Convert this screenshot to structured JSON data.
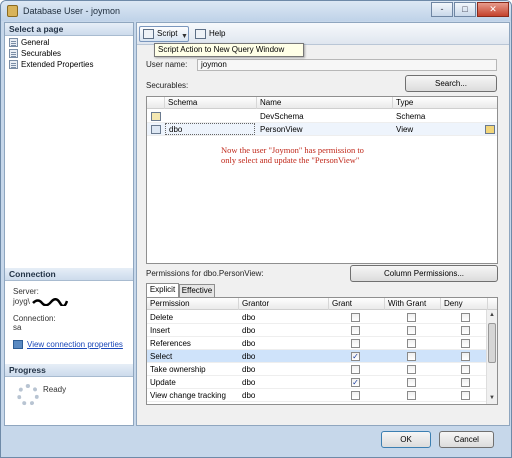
{
  "window": {
    "title": "Database User - joymon",
    "controls": [
      "-",
      "□",
      "✕"
    ]
  },
  "left": {
    "select_page_header": "Select a page",
    "pages": [
      "General",
      "Securables",
      "Extended Properties"
    ],
    "connection_header": "Connection",
    "server_label": "Server:",
    "server_value": "joyg\\",
    "connection_label": "Connection:",
    "connection_value": "sa",
    "view_connection_link": "View connection properties",
    "progress_header": "Progress",
    "progress_status": "Ready"
  },
  "toolbar": {
    "script_label": "Script",
    "help_label": "Help",
    "tooltip": "Script Action to New Query Window"
  },
  "form": {
    "user_name_label": "User name:",
    "user_name_value": "joymon",
    "securables_label": "Securables:",
    "search_button": "Search..."
  },
  "securables_table": {
    "headers": [
      "Schema",
      "Name",
      "Type"
    ],
    "rows": [
      {
        "schema": "",
        "name": "DevSchema",
        "type": "Schema"
      },
      {
        "schema": "dbo",
        "name": "PersonView",
        "type": "View"
      }
    ]
  },
  "annotation": "Now the user \"Joymon\" has permission to only select and update the \"PersonView\"",
  "permissions": {
    "label": "Permissions for dbo.PersonView:",
    "column_permissions_button": "Column Permissions...",
    "tabs": [
      "Explicit",
      "Effective"
    ],
    "headers": [
      "Permission",
      "Grantor",
      "Grant",
      "With Grant",
      "Deny"
    ],
    "rows": [
      {
        "permission": "Delete",
        "grantor": "dbo",
        "grant": false,
        "with_grant": false,
        "deny": false
      },
      {
        "permission": "Insert",
        "grantor": "dbo",
        "grant": false,
        "with_grant": false,
        "deny": false
      },
      {
        "permission": "References",
        "grantor": "dbo",
        "grant": false,
        "with_grant": false,
        "deny": false
      },
      {
        "permission": "Select",
        "grantor": "dbo",
        "grant": true,
        "with_grant": false,
        "deny": false
      },
      {
        "permission": "Take ownership",
        "grantor": "dbo",
        "grant": false,
        "with_grant": false,
        "deny": false
      },
      {
        "permission": "Update",
        "grantor": "dbo",
        "grant": true,
        "with_grant": false,
        "deny": false
      },
      {
        "permission": "View change tracking",
        "grantor": "dbo",
        "grant": false,
        "with_grant": false,
        "deny": false
      }
    ]
  },
  "footer": {
    "ok_button": "OK",
    "cancel_button": "Cancel"
  },
  "colors": {
    "annotation": "#c0281a",
    "selection": "#cfe3fa",
    "link": "#1a47b8"
  }
}
